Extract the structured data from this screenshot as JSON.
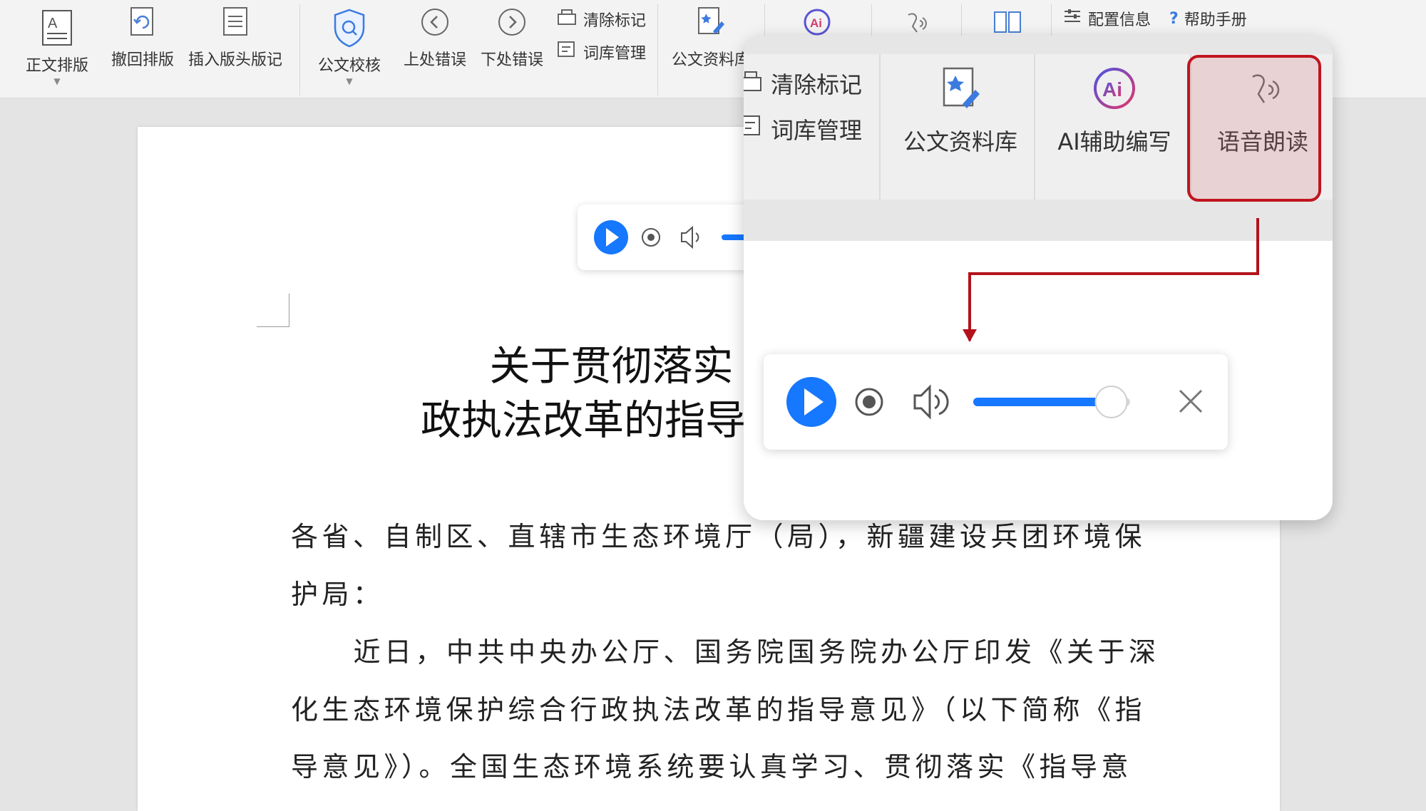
{
  "ribbon": {
    "typeset_label": "正文排版",
    "undo_typeset_label": "撤回排版",
    "insert_header_label": "插入版头版记",
    "proofread_label": "公文校核",
    "prev_error_label": "上处错误",
    "next_error_label": "下处错误",
    "clear_marks_label": "清除标记",
    "lexicon_label": "词库管理",
    "library_label": "公文资料库",
    "config_label": "配置信息",
    "help_label": "帮助手册",
    "help_prefix": "?"
  },
  "zoom_ribbon": {
    "clear_marks_label": "清除标记",
    "lexicon_label": "词库管理",
    "library_label": "公文资料库",
    "ai_label": "AI辅助编写",
    "tts_label": "语音朗读"
  },
  "document": {
    "title_line1": "关于贯彻落实《关于深化",
    "title_line2": "政执法改革的指导",
    "paragraphs": [
      "各省、自制区、直辖市生态环境厅（局），新疆建设兵团环境保",
      "护局：",
      "　近日，中共中央办公厅、国务院国务院办公厅印发《关于深",
      "化生态环境保护综合行政执法改革的指导意见》（以下简称《指",
      "导意见》）。全国生态环境系统要认真学习、贯彻落实《指导意"
    ]
  },
  "player": {
    "volume_fraction": 0.88
  },
  "colors": {
    "accent_blue": "#1677ff",
    "highlight_red": "#c0151f"
  }
}
